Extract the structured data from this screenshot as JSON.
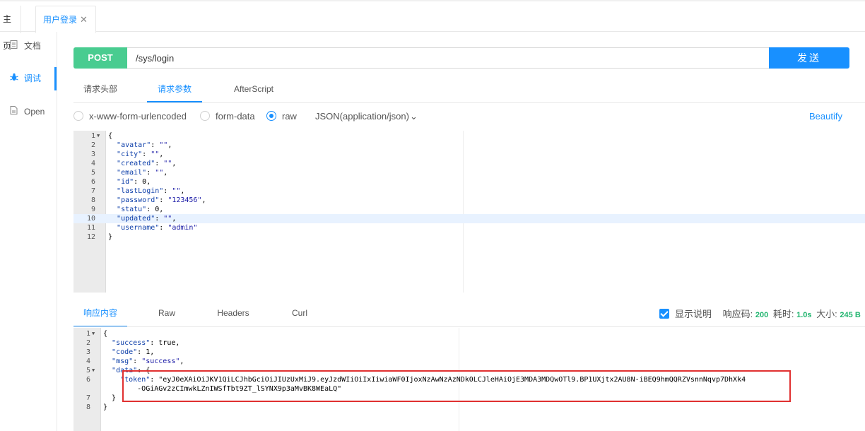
{
  "tabs": {
    "home": "主页",
    "active": "用户登录",
    "close": "✕"
  },
  "sidebar": {
    "items": [
      {
        "label": "文档",
        "icon": "document-icon"
      },
      {
        "label": "调试",
        "icon": "bug-icon"
      },
      {
        "label": "Open",
        "icon": "file-icon"
      }
    ]
  },
  "request": {
    "method": "POST",
    "url": "/sys/login",
    "send_label": "发送",
    "tabs": [
      "请求头部",
      "请求参数",
      "AfterScript"
    ],
    "active_tab": "请求参数",
    "body_types": [
      "x-www-form-urlencoded",
      "form-data",
      "raw"
    ],
    "selected_body_type": "raw",
    "content_type": "JSON(application/json)",
    "content_type_caret": "⌄",
    "beautify_label": "Beautify",
    "body_lines": [
      "{",
      "  \"avatar\": \"\",",
      "  \"city\": \"\",",
      "  \"created\": \"\",",
      "  \"email\": \"\",",
      "  \"id\": 0,",
      "  \"lastLogin\": \"\",",
      "  \"password\": \"123456\",",
      "  \"statu\": 0,",
      "  \"updated\": \"\",",
      "  \"username\": \"admin\"",
      "}"
    ],
    "highlight_line": 10
  },
  "response": {
    "tabs": [
      "响应内容",
      "Raw",
      "Headers",
      "Curl"
    ],
    "active_tab": "响应内容",
    "show_desc_label": "显示说明",
    "status_label": "响应码:",
    "status_value": "200",
    "time_label": "耗时:",
    "time_value": "1.0s",
    "size_label": "大小:",
    "size_value": "245 B",
    "body_lines": [
      "{",
      "  \"success\": true,",
      "  \"code\": 1,",
      "  \"msg\": \"success\",",
      "  \"data\": {",
      "    \"token\": \"eyJ0eXAiOiJKV1QiLCJhbGciOiJIUzUxMiJ9.eyJzdWIiOiIxIiwiaWF0IjoxNzAwNzAzNDk0LCJleHAiOjE3MDA3MDQwOTl9.BP1UXjtx2AU8N-iBEQ9hmQQRZVsnnNqvp7DhXk4",
      "        -OGiAGv2zCImwkLZnIWSfTbt9ZT_lSYNX9p3aMvBK8WEaLQ\"",
      "  }",
      "}"
    ],
    "line_numbers": [
      "1",
      "2",
      "3",
      "4",
      "5",
      "6",
      "",
      "7",
      "8"
    ],
    "fold_lines": [
      "1",
      "5"
    ]
  }
}
